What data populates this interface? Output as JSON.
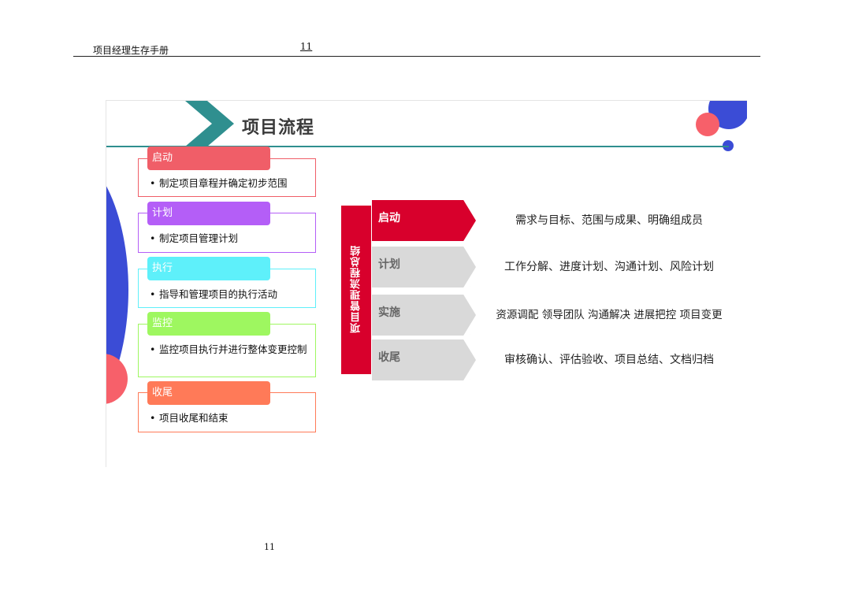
{
  "header": {
    "title": "项目经理生存手册",
    "page_number": "11"
  },
  "footer": {
    "page_number": "11"
  },
  "slide": {
    "title": "项目流程",
    "stages": [
      {
        "label": "启动",
        "description": "制定项目章程并确定初步范围",
        "color": "#f05e68"
      },
      {
        "label": "计划",
        "description": "制定项目管理计划",
        "color": "#b45ef7"
      },
      {
        "label": "执行",
        "description": "指导和管理项目的执行活动",
        "color": "#5ef0fa"
      },
      {
        "label": "监控",
        "description": "监控项目执行并进行整体变更控制",
        "color": "#9ef760"
      },
      {
        "label": "收尾",
        "description": "项目收尾和结束",
        "color": "#ff7a58"
      }
    ],
    "summary": {
      "title": "项目管理流程总结",
      "rows": [
        {
          "label": "启动",
          "content": "需求与目标、范围与成果、明确组成员",
          "active": true
        },
        {
          "label": "计划",
          "content": "工作分解、进度计划、沟通计划、风险计划",
          "active": false
        },
        {
          "label": "实施",
          "content": "资源调配 领导团队 沟通解决 进展把控 项目变更",
          "active": false
        },
        {
          "label": "收尾",
          "content": "审核确认、评估验收、项目总结、文档归档",
          "active": false
        }
      ]
    },
    "colors": {
      "accent_red": "#d8002c",
      "teal": "#2f8f8f",
      "blue": "#3b4cd6",
      "coral": "#f7606a"
    }
  }
}
